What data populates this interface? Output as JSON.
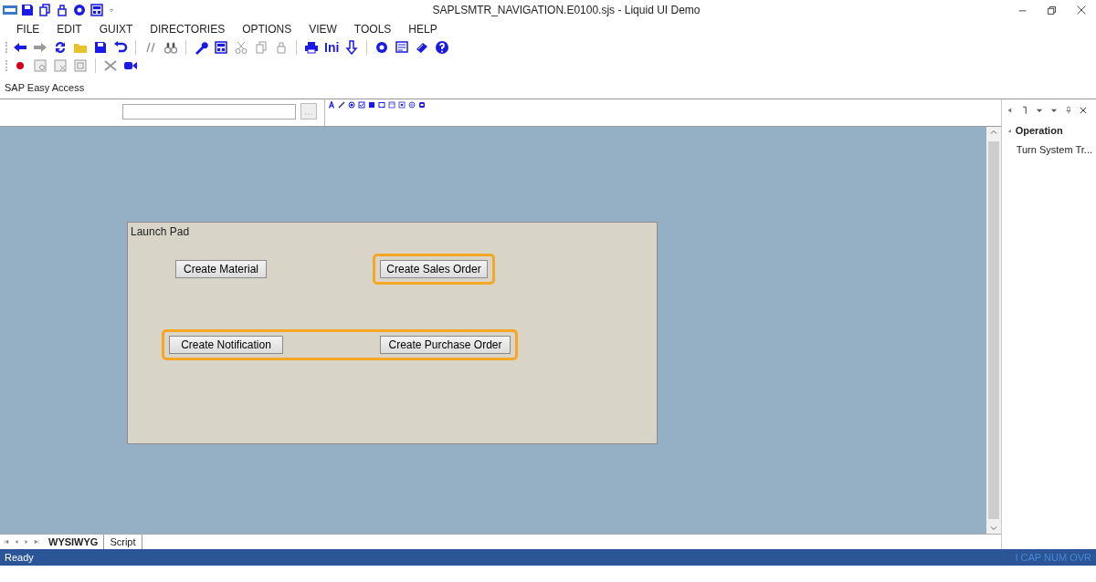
{
  "window": {
    "title": "SAPLSMTR_NAVIGATION.E0100.sjs - Liquid UI Demo"
  },
  "menu": [
    "FILE",
    "EDIT",
    "GUIXT",
    "DIRECTORIES",
    "OPTIONS",
    "VIEW",
    "TOOLS",
    "HELP"
  ],
  "toolbar": {
    "ini_label": "Ini"
  },
  "screen_title": "SAP Easy Access",
  "canvas": {
    "group_title": "Launch Pad",
    "buttons": [
      {
        "label": "Create Material",
        "highlighted": false
      },
      {
        "label": "Create Sales Order",
        "highlighted": true
      },
      {
        "label": "Create Notification",
        "highlighted": true
      },
      {
        "label": "Create Purchase Order",
        "highlighted": true
      }
    ]
  },
  "side_panel": {
    "heading": "Operation",
    "expanded": true,
    "items": [
      "Turn System Tr..."
    ]
  },
  "tabs": [
    {
      "label": "WYSIWYG",
      "selected": true
    },
    {
      "label": "Script",
      "selected": false
    }
  ],
  "status_bar": {
    "message": "Ready",
    "indicators": "I CAP NUM OVR"
  }
}
